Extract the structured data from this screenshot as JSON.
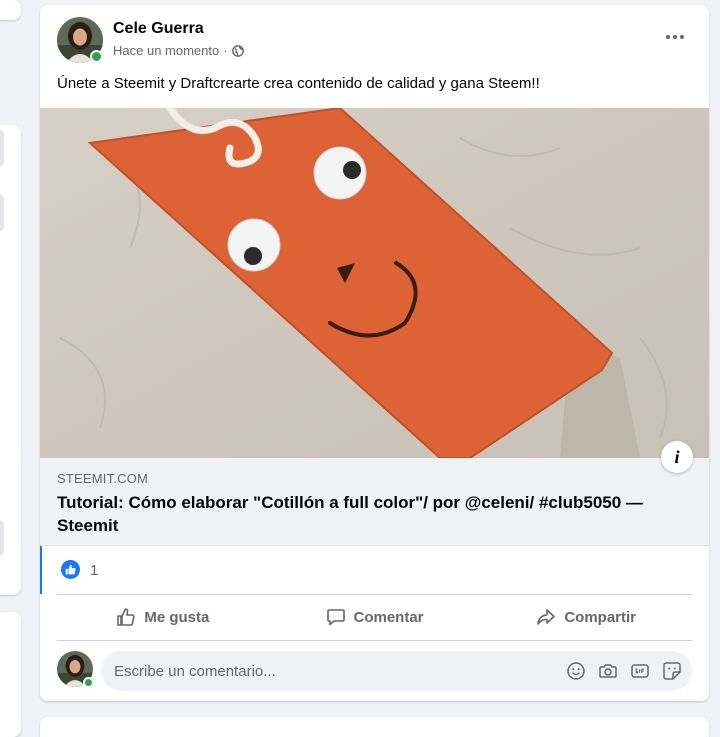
{
  "post": {
    "author": "Cele Guerra",
    "timestamp": "Hace un momento",
    "separator": "·",
    "privacy_icon": "globe-icon",
    "text": "Únete a Steemit y Draftcrearte crea contenido de calidad y gana Steem!!",
    "link": {
      "domain": "STEEMIT.COM",
      "title": "Tutorial: Cómo elaborar \"Cotillón a full color\"/ por @celeni/ #club5050 — Steemit"
    },
    "reactions": {
      "count": "1",
      "icon": "like-icon"
    },
    "actions": {
      "like": "Me gusta",
      "comment": "Comentar",
      "share": "Compartir"
    },
    "comment": {
      "placeholder": "Escribe un comentario..."
    }
  },
  "colors": {
    "brand": "#1877f2",
    "online": "#31a24c",
    "secondary_text": "#65676b"
  }
}
